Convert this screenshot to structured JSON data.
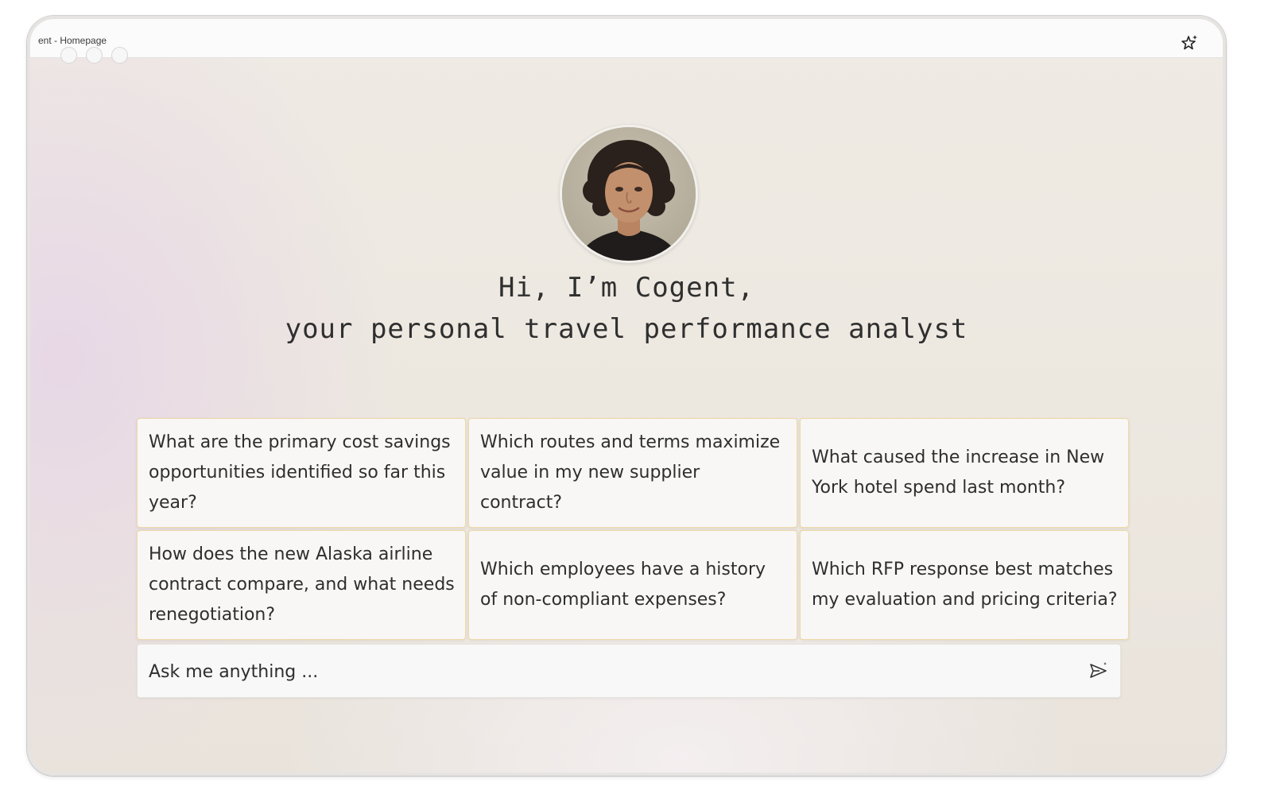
{
  "window": {
    "tab_title": "ent - Homepage"
  },
  "assistant": {
    "greeting_line1": "Hi, I’m Cogent,",
    "greeting_line2": "your personal travel performance analyst"
  },
  "suggestions": [
    "What are the primary cost savings opportunities identified so far this year?",
    "Which routes and terms maximize value in my new supplier contract?",
    "What caused the increase in New York hotel spend last month?",
    "How does the new Alaska airline contract compare, and what needs renegotiation?",
    "Which employees have a history of non-compliant expenses?",
    "Which RFP response best matches my evaluation and pricing criteria?"
  ],
  "chat": {
    "placeholder": "Ask me anything ..."
  },
  "icons": {
    "titlebar_right": "sparkle-star-icon",
    "send": "send-icon"
  },
  "colors": {
    "card_border": "#edd9a8",
    "text": "#2e2e2e"
  }
}
